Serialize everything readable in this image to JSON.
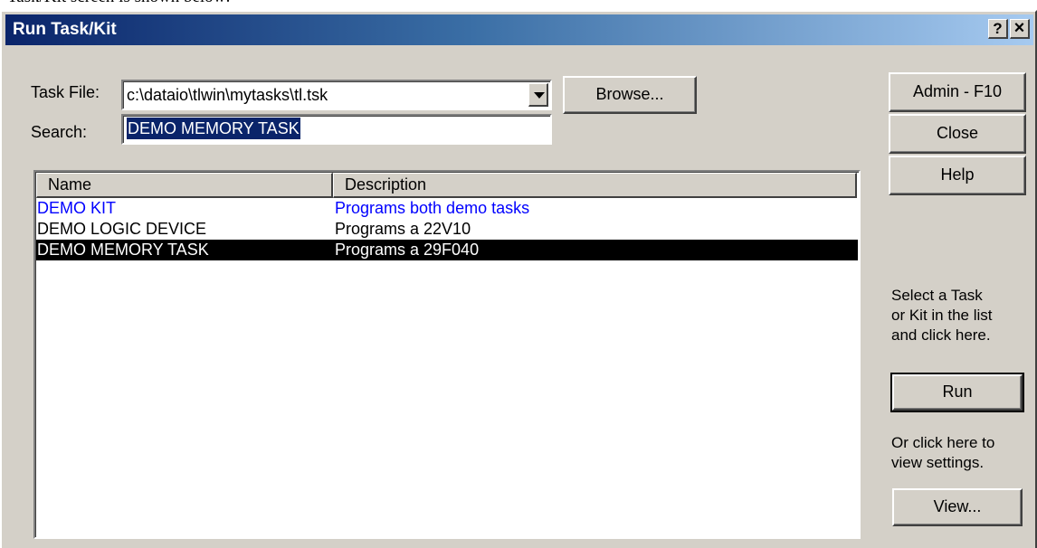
{
  "page_caption": "Task/Kit screen is shown below:",
  "window": {
    "title": "Run Task/Kit",
    "help_button": "?",
    "close_button": "×"
  },
  "task_file": {
    "label": "Task File:",
    "value": "c:\\dataio\\tlwin\\mytasks\\tl.tsk",
    "browse_label": "Browse..."
  },
  "search": {
    "label": "Search:",
    "value": "DEMO MEMORY TASK"
  },
  "list": {
    "columns": [
      "Name",
      "Description"
    ],
    "rows": [
      {
        "name": "DEMO KIT",
        "description": "Programs both demo tasks",
        "type": "kit",
        "color": "#0000ff"
      },
      {
        "name": "DEMO LOGIC DEVICE",
        "description": "Programs a 22V10",
        "type": "task"
      },
      {
        "name": "DEMO MEMORY TASK",
        "description": "Programs a 29F040",
        "type": "task",
        "selected": true
      }
    ]
  },
  "side": {
    "admin_label": "Admin - F10",
    "close_label": "Close",
    "help_label": "Help",
    "run_hint": [
      "Select a Task",
      "or Kit in the list",
      "and click here."
    ],
    "run_label": "Run",
    "view_hint": [
      "Or click here to",
      "view settings."
    ],
    "view_label": "View..."
  },
  "colors": {
    "face": "#d4d0c8",
    "title_start": "#0a246a",
    "title_end": "#a6caf0",
    "selection": "#000000"
  }
}
